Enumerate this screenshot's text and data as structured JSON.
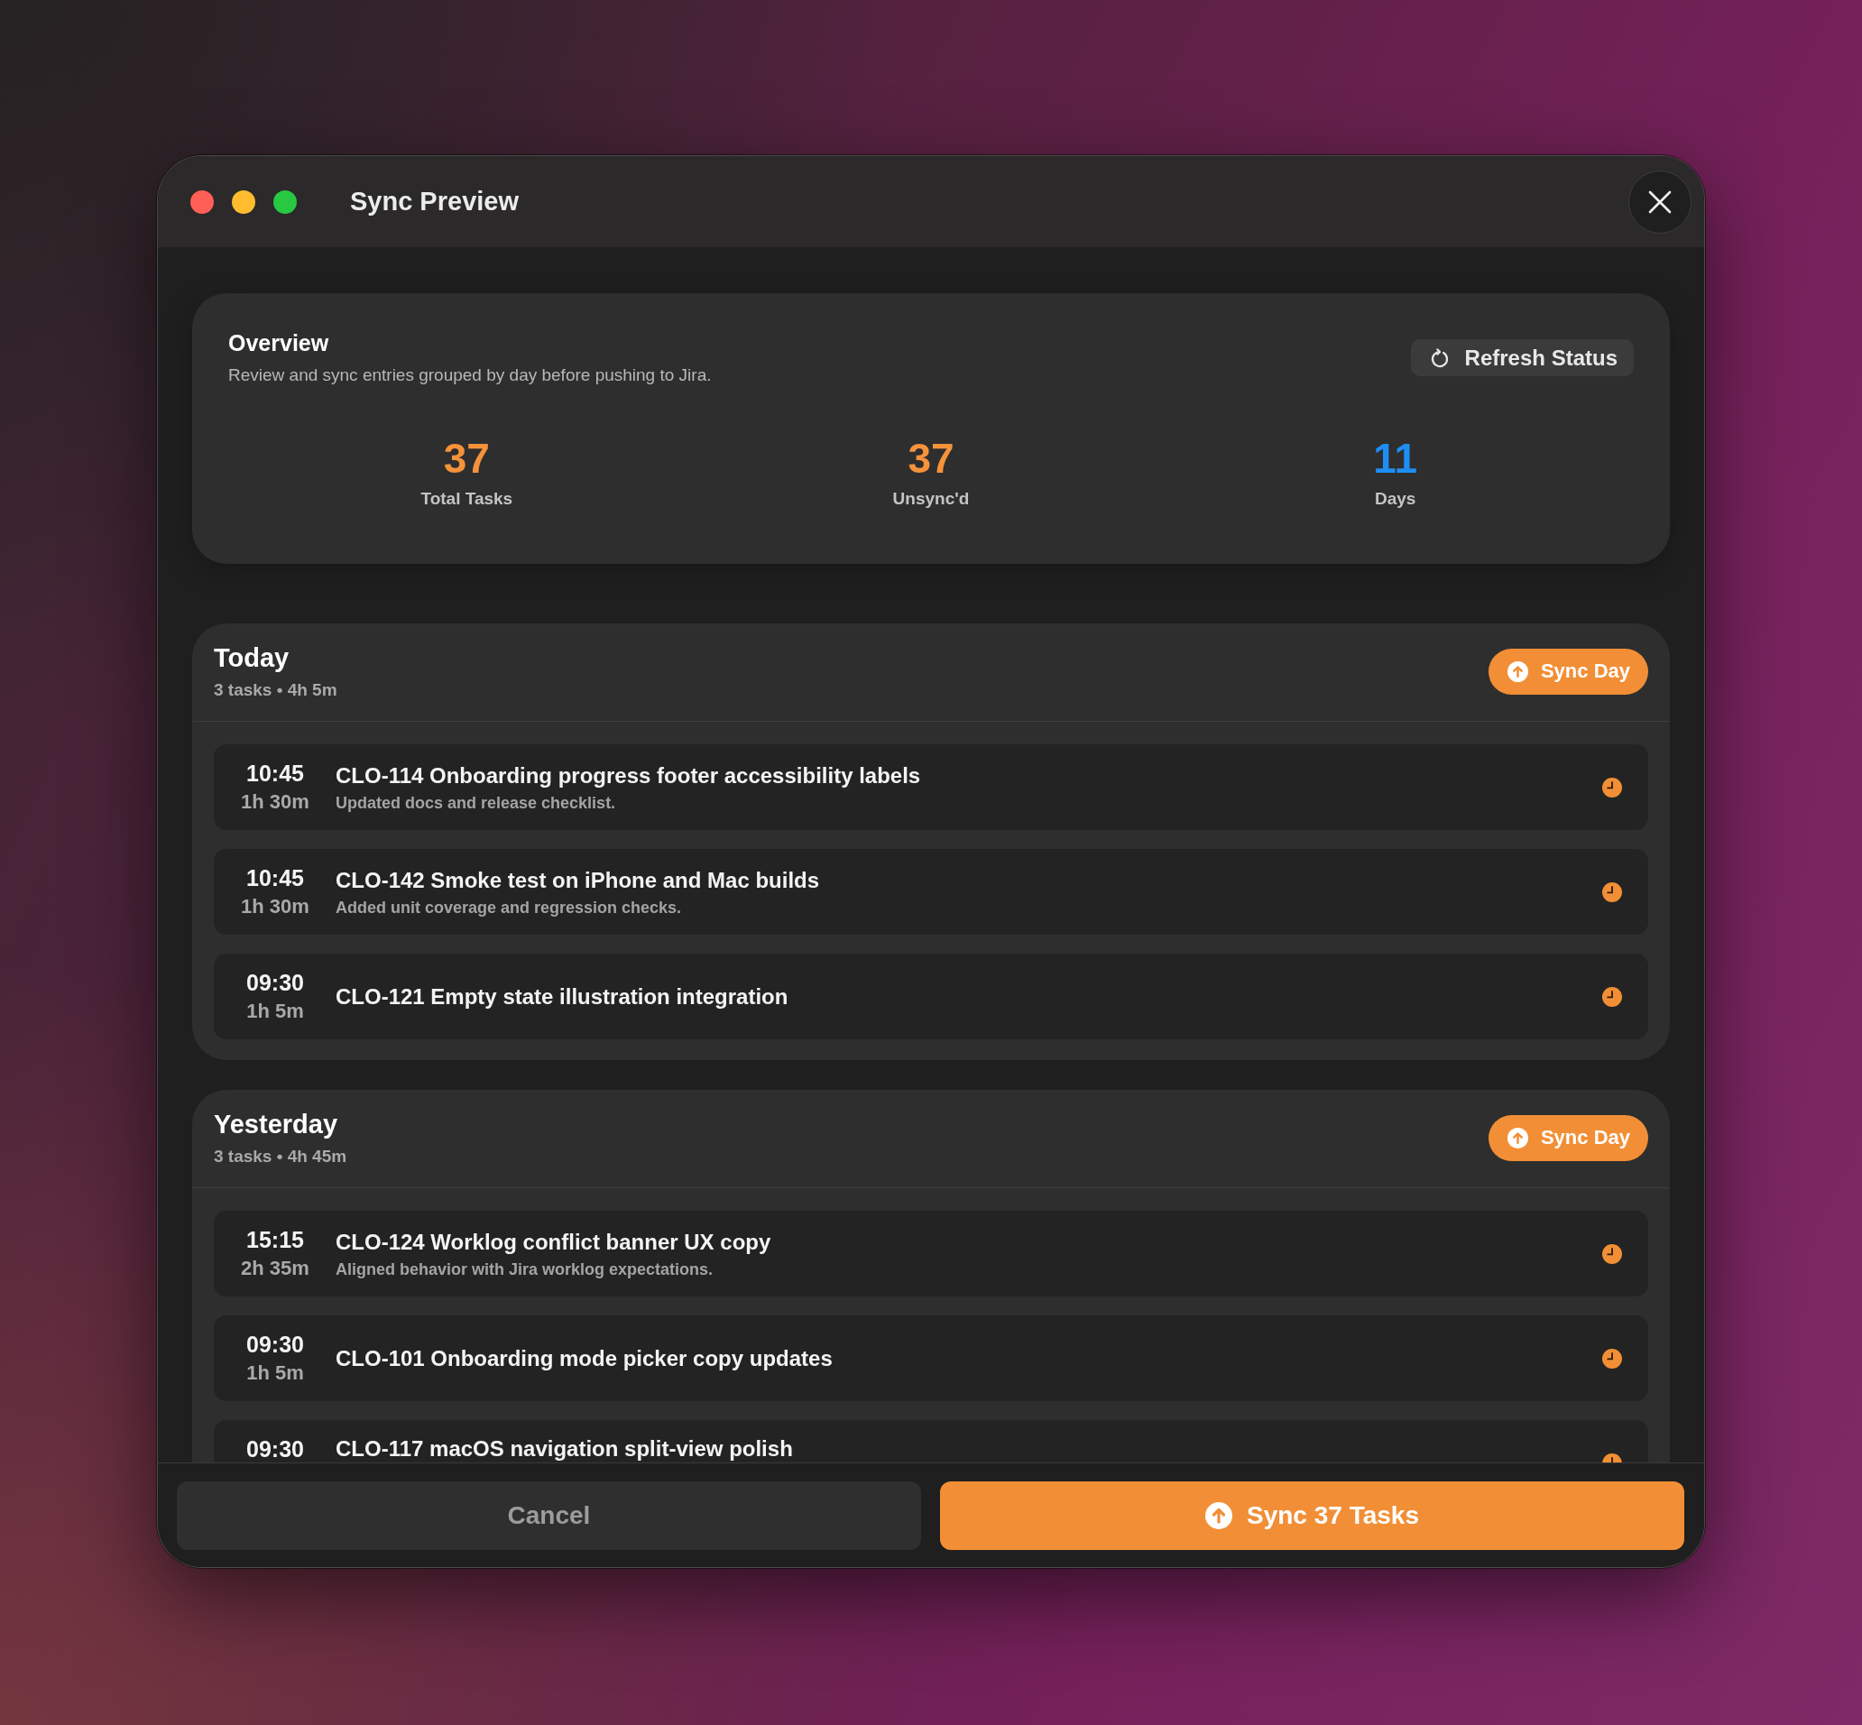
{
  "window": {
    "title": "Sync Preview"
  },
  "overview": {
    "title": "Overview",
    "description": "Review and sync entries grouped by day before pushing to Jira.",
    "refresh_button": "Refresh Status",
    "stats": [
      {
        "value": "37",
        "label": "Total Tasks",
        "color": "#f5923a"
      },
      {
        "value": "37",
        "label": "Unsync'd",
        "color": "#f5923a"
      },
      {
        "value": "11",
        "label": "Days",
        "color": "#1e8ef5"
      }
    ]
  },
  "days": [
    {
      "title": "Today",
      "summary": "3 tasks • 4h 5m",
      "sync_button": "Sync Day",
      "entries": [
        {
          "time": "10:45",
          "duration": "1h 30m",
          "title": "CLO-114 Onboarding progress footer accessibility labels",
          "note": "Updated docs and release checklist.",
          "synced": false
        },
        {
          "time": "10:45",
          "duration": "1h 30m",
          "title": "CLO-142 Smoke test on iPhone and Mac builds",
          "note": "Added unit coverage and regression checks.",
          "synced": false
        },
        {
          "time": "09:30",
          "duration": "1h 5m",
          "title": "CLO-121 Empty state illustration integration",
          "synced": false
        }
      ]
    },
    {
      "title": "Yesterday",
      "summary": "3 tasks • 4h 45m",
      "sync_button": "Sync Day",
      "entries": [
        {
          "time": "15:15",
          "duration": "2h 35m",
          "title": "CLO-124 Worklog conflict banner UX copy",
          "note": "Aligned behavior with Jira worklog expectations.",
          "synced": false
        },
        {
          "time": "09:30",
          "duration": "1h 5m",
          "title": "CLO-101 Onboarding mode picker copy updates",
          "synced": false
        },
        {
          "time": "09:30",
          "title": "CLO-117 macOS navigation split-view polish",
          "synced": false
        }
      ]
    }
  ],
  "footer": {
    "cancel_button": "Cancel",
    "sync_button": "Sync 37 Tasks"
  }
}
